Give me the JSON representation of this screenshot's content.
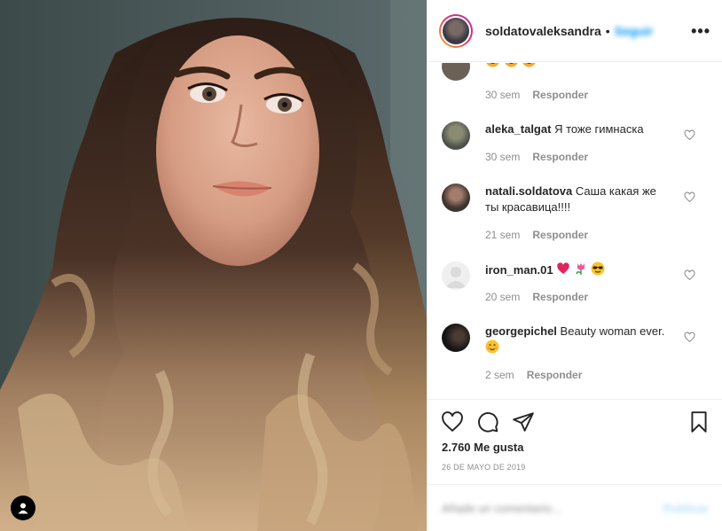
{
  "post": {
    "photo_alt": "selfie"
  },
  "header": {
    "username": "soldatovaleksandra",
    "separator": "•",
    "follow_label": "Seguir",
    "more_label": "•••"
  },
  "comments": [
    {
      "user": "",
      "text": "",
      "emoji": [
        "star-struck",
        "star-struck",
        "star-struck"
      ],
      "time": "30 sem",
      "reply": "Responder"
    },
    {
      "user": "aleka_talgat",
      "text": "Я тоже гимнаска",
      "time": "30 sem",
      "reply": "Responder"
    },
    {
      "user": "natali.soldatova",
      "text": "Саша какая же ты красавица!!!!",
      "time": "21 sem",
      "reply": "Responder"
    },
    {
      "user": "iron_man.01",
      "text": "",
      "emoji": [
        "red-heart",
        "tulip",
        "sunglasses-face"
      ],
      "time": "20 sem",
      "reply": "Responder"
    },
    {
      "user": "georgepichel",
      "text": "Beauty woman ever.",
      "emoji": [
        "smiling-face"
      ],
      "time": "2 sem",
      "reply": "Responder"
    }
  ],
  "actions": {
    "likes": "2.760 Me gusta",
    "date": "26 DE MAYO DE 2019"
  },
  "add_comment": {
    "placeholder": "Añade un comentario...",
    "publish": "Publicar"
  },
  "colors": {
    "accent": "#0095f6",
    "muted": "#8e8e8e",
    "text": "#262626",
    "border": "#efefef",
    "heart_red": "#ed1c24"
  }
}
